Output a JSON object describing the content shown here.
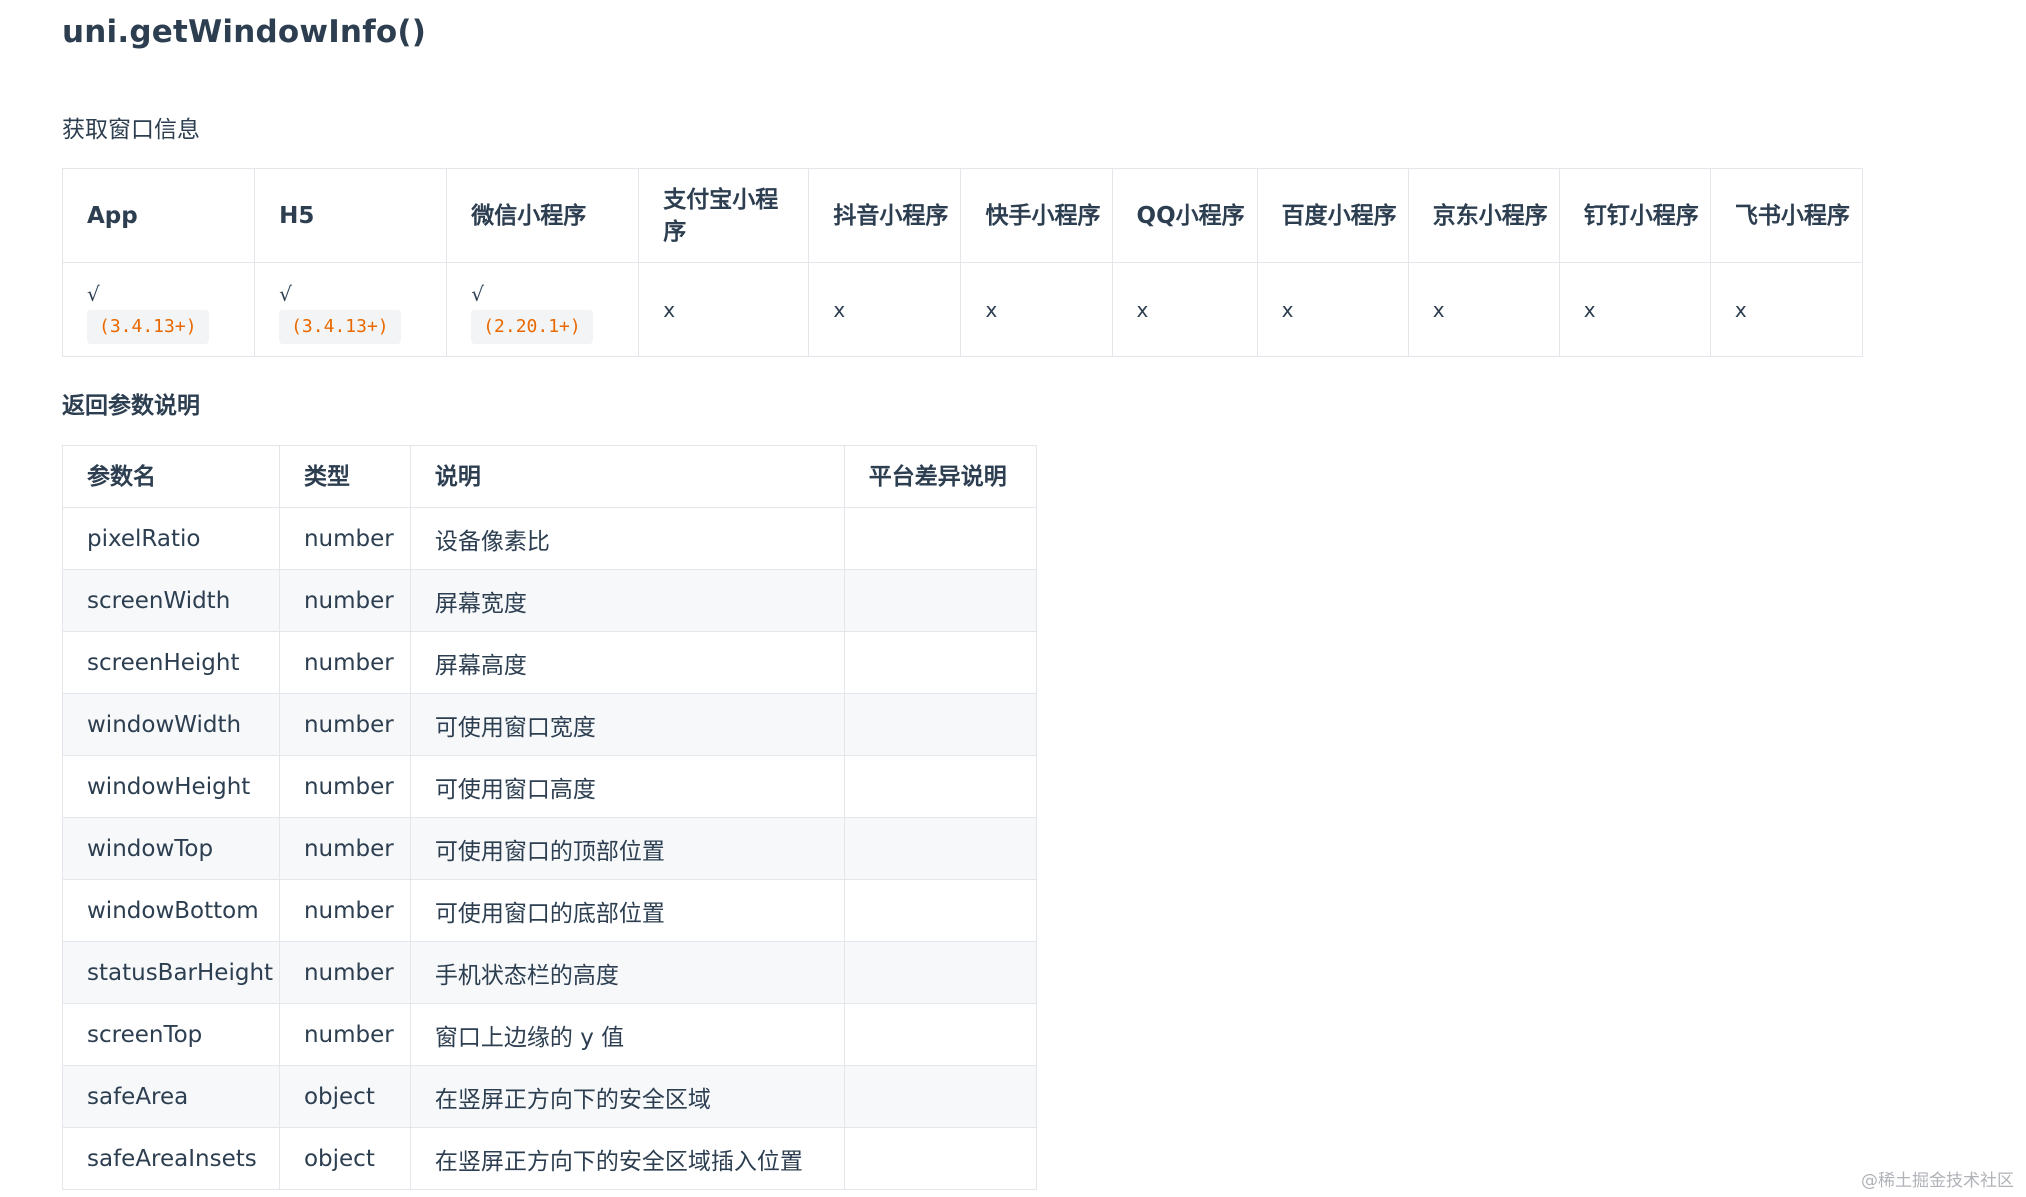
{
  "page": {
    "title": "uni.getWindowInfo()",
    "subtitle": "获取窗口信息",
    "section_heading": "返回参数说明",
    "watermark": "@稀土掘金技术社区"
  },
  "platform_table": {
    "headers": [
      "App",
      "H5",
      "微信小程序",
      "支付宝小程序",
      "抖音小程序",
      "快手小程序",
      "QQ小程序",
      "百度小程序",
      "京东小程序",
      "钉钉小程序",
      "飞书小程序"
    ],
    "cells": [
      {
        "mark": "√",
        "version": "(3.4.13+)"
      },
      {
        "mark": "√",
        "version": "(3.4.13+)"
      },
      {
        "mark": "√",
        "version": "(2.20.1+)"
      },
      {
        "mark": "x"
      },
      {
        "mark": "x"
      },
      {
        "mark": "x"
      },
      {
        "mark": "x"
      },
      {
        "mark": "x"
      },
      {
        "mark": "x"
      },
      {
        "mark": "x"
      },
      {
        "mark": "x"
      }
    ]
  },
  "params_table": {
    "headers": [
      "参数名",
      "类型",
      "说明",
      "平台差异说明"
    ],
    "rows": [
      {
        "name": "pixelRatio",
        "type": "number",
        "desc": "设备像素比",
        "note": ""
      },
      {
        "name": "screenWidth",
        "type": "number",
        "desc": "屏幕宽度",
        "note": ""
      },
      {
        "name": "screenHeight",
        "type": "number",
        "desc": "屏幕高度",
        "note": ""
      },
      {
        "name": "windowWidth",
        "type": "number",
        "desc": "可使用窗口宽度",
        "note": ""
      },
      {
        "name": "windowHeight",
        "type": "number",
        "desc": "可使用窗口高度",
        "note": ""
      },
      {
        "name": "windowTop",
        "type": "number",
        "desc": "可使用窗口的顶部位置",
        "note": ""
      },
      {
        "name": "windowBottom",
        "type": "number",
        "desc": "可使用窗口的底部位置",
        "note": ""
      },
      {
        "name": "statusBarHeight",
        "type": "number",
        "desc": "手机状态栏的高度",
        "note": ""
      },
      {
        "name": "screenTop",
        "type": "number",
        "desc": "窗口上边缘的 y 值",
        "note": ""
      },
      {
        "name": "safeArea",
        "type": "object",
        "desc": "在竖屏正方向下的安全区域",
        "note": ""
      },
      {
        "name": "safeAreaInsets",
        "type": "object",
        "desc": "在竖屏正方向下的安全区域插入位置",
        "note": ""
      }
    ]
  }
}
